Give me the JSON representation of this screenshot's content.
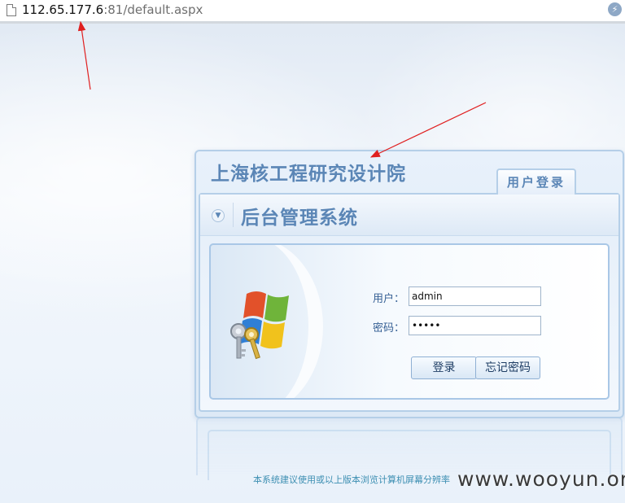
{
  "browser": {
    "url_host": "112.65.177.6",
    "url_rest": ":81/default.aspx",
    "page_icon": "document-icon",
    "extension_icon": "bolt-icon"
  },
  "panel": {
    "org_name": "上海核工程研究设计院",
    "login_tab": "用户登录",
    "system_title": "后台管理系统",
    "chevron_icon": "chevron-down-icon",
    "logo": "windows-keys-logo"
  },
  "form": {
    "username_label": "用户：",
    "username_value": "admin",
    "password_label": "密码：",
    "password_value": "•••••",
    "login_button": "登录",
    "forgot_button": "忘记密码"
  },
  "footer": {
    "note": "本系统建议使用或以上版本浏览计算机屏幕分辨率"
  },
  "watermark": "www.wooyun.org",
  "colors": {
    "accent": "#5b86b6",
    "label": "#355f94",
    "arrow": "#e02020",
    "footer_text": "#3d8fb2"
  }
}
